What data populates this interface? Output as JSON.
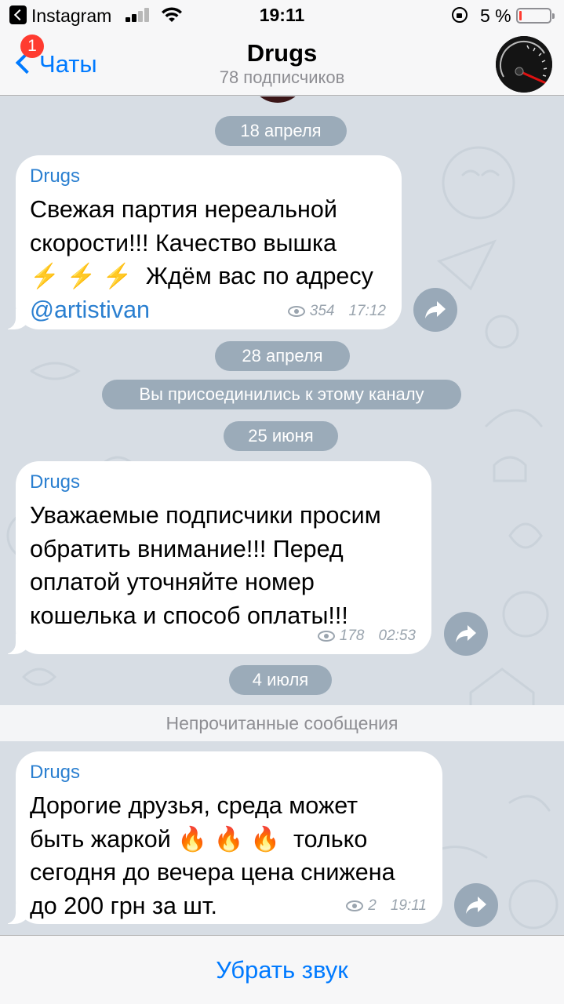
{
  "status_bar": {
    "app_name": "Instagram",
    "time": "19:11",
    "battery_percent": "5 %"
  },
  "nav": {
    "back_label": "Чаты",
    "back_badge": "1",
    "title": "Drugs",
    "subtitle": "78 подписчиков"
  },
  "chat": {
    "dates": {
      "apr18": "18 апреля",
      "apr28": "28 апреля",
      "jun25": "25 июня",
      "jul4": "4 июля"
    },
    "joined_notice": "Вы присоединились к этому каналу",
    "unread_label": "Непрочитанные сообщения",
    "messages": [
      {
        "sender": "Drugs",
        "text_before_link": "Свежая партия нереальной\nскорости!!! Качество вышка\n⚡ ⚡ ⚡  Ждём вас по адресу\n",
        "link": "@artistivan",
        "views": "354",
        "time": "17:12"
      },
      {
        "sender": "Drugs",
        "text": "Уважаемые подписчики просим\nобратить внимание!!! Перед\nоплатой уточняйте номер\nкошелька и способ оплаты!!!",
        "views": "178",
        "time": "02:53"
      },
      {
        "sender": "Drugs",
        "text": "Дорогие друзья, среда может\nбыть жаркой 🔥 🔥 🔥  только\nсегодня до вечера цена снижена\nдо 200 грн за шт.",
        "views": "2",
        "time": "19:11"
      }
    ]
  },
  "bottom": {
    "mute_label": "Убрать звук"
  },
  "icons": [
    "back-chevron-icon",
    "signal-icon",
    "wifi-icon",
    "rotation-lock-icon",
    "battery-icon",
    "eye-icon",
    "share-icon",
    "speedometer-avatar"
  ],
  "colors": {
    "accent": "#007aff",
    "link": "#2a7fd0",
    "badge": "#ff3b30",
    "chat_background": "#d7dde4",
    "bubble": "#ffffff"
  }
}
